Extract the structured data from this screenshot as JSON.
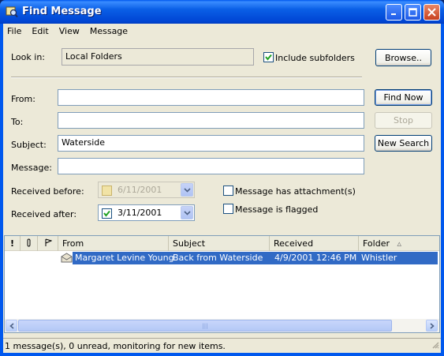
{
  "window": {
    "title": "Find Message"
  },
  "menu": [
    "File",
    "Edit",
    "View",
    "Message"
  ],
  "look_in": {
    "label": "Look in:",
    "value": "Local Folders",
    "include_label": "Include subfolders",
    "include_checked": true,
    "browse_label": "Browse.."
  },
  "fields": {
    "from_label": "From:",
    "from_value": "",
    "to_label": "To:",
    "to_value": "",
    "subject_label": "Subject:",
    "subject_value": "Waterside",
    "message_label": "Message:",
    "message_value": ""
  },
  "buttons": {
    "find_now": "Find Now",
    "stop": "Stop",
    "new_search": "New Search"
  },
  "dates": {
    "before_label": "Received before:",
    "before_value": "6/11/2001",
    "before_checked": false,
    "after_label": "Received after:",
    "after_value": "3/11/2001",
    "after_checked": true
  },
  "options": {
    "attachment_label": "Message has attachment(s)",
    "flagged_label": "Message is flagged"
  },
  "results": {
    "columns": [
      "!",
      "0",
      "",
      "From",
      "Subject",
      "Received",
      "Folder"
    ],
    "rows": [
      {
        "from": "Margaret Levine Young",
        "subject": "Back from Waterside",
        "received": "4/9/2001 12:46 PM",
        "folder": "Whistler"
      }
    ]
  },
  "status": "1 message(s), 0 unread, monitoring for new items."
}
